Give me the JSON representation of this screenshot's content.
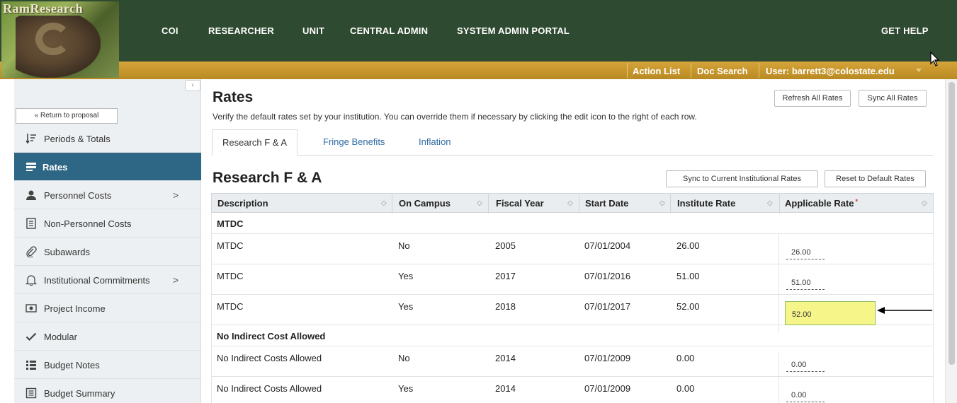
{
  "header": {
    "logo_text": "RamResearch",
    "nav": [
      "COI",
      "RESEARCHER",
      "UNIT",
      "CENTRAL ADMIN",
      "SYSTEM ADMIN PORTAL"
    ],
    "help": "GET HELP",
    "action_list": "Action List",
    "doc_search": "Doc Search",
    "user": "User: barrett3@colostate.edu"
  },
  "sidebar": {
    "return_label": "« Return to proposal",
    "items": [
      {
        "label": "Periods & Totals",
        "icon": "sort-list-icon"
      },
      {
        "label": "Rates",
        "icon": "rates-icon",
        "active": true
      },
      {
        "label": "Personnel Costs",
        "icon": "person-icon",
        "chevron": ">"
      },
      {
        "label": "Non-Personnel Costs",
        "icon": "document-icon"
      },
      {
        "label": "Subawards",
        "icon": "paperclip-icon"
      },
      {
        "label": "Institutional Commitments",
        "icon": "bell-icon",
        "chevron": ">"
      },
      {
        "label": "Project Income",
        "icon": "money-icon"
      },
      {
        "label": "Modular",
        "icon": "checkmark-icon"
      },
      {
        "label": "Budget Notes",
        "icon": "list-icon"
      },
      {
        "label": "Budget Summary",
        "icon": "summary-icon"
      }
    ]
  },
  "main": {
    "title": "Rates",
    "subtitle": "Verify the default rates set by your institution. You can override them if necessary by clicking the edit icon to the right of each row.",
    "refresh_all": "Refresh All Rates",
    "sync_all": "Sync All Rates",
    "tabs": [
      "Research F & A",
      "Fringe Benefits",
      "Inflation"
    ],
    "section_title": "Research F & A",
    "sync_current": "Sync to Current Institutional Rates",
    "reset_default": "Reset to Default Rates",
    "columns": [
      "Description",
      "On Campus",
      "Fiscal Year",
      "Start Date",
      "Institute Rate",
      "Applicable Rate"
    ],
    "required_mark": "*",
    "groups": [
      {
        "name": "MTDC",
        "rows": [
          {
            "description": "MTDC",
            "on_campus": "No",
            "fiscal_year": "2005",
            "start_date": "07/01/2004",
            "institute_rate": "26.00",
            "applicable_rate": "26.00"
          },
          {
            "description": "MTDC",
            "on_campus": "Yes",
            "fiscal_year": "2017",
            "start_date": "07/01/2016",
            "institute_rate": "51.00",
            "applicable_rate": "51.00"
          },
          {
            "description": "MTDC",
            "on_campus": "Yes",
            "fiscal_year": "2018",
            "start_date": "07/01/2017",
            "institute_rate": "52.00",
            "applicable_rate": "52.00",
            "editing": true
          }
        ]
      },
      {
        "name": "No Indirect Cost Allowed",
        "rows": [
          {
            "description": "No Indirect Costs Allowed",
            "on_campus": "No",
            "fiscal_year": "2014",
            "start_date": "07/01/2009",
            "institute_rate": "0.00",
            "applicable_rate": "0.00"
          },
          {
            "description": "No Indirect Costs Allowed",
            "on_campus": "Yes",
            "fiscal_year": "2014",
            "start_date": "07/01/2009",
            "institute_rate": "0.00",
            "applicable_rate": "0.00"
          }
        ]
      }
    ]
  },
  "colors": {
    "header_green": "#2e4a30",
    "gold": "#c99a2e",
    "active_sidebar": "#2e6685",
    "link_blue": "#2f6aa3",
    "edit_highlight": "#f6f58a"
  }
}
